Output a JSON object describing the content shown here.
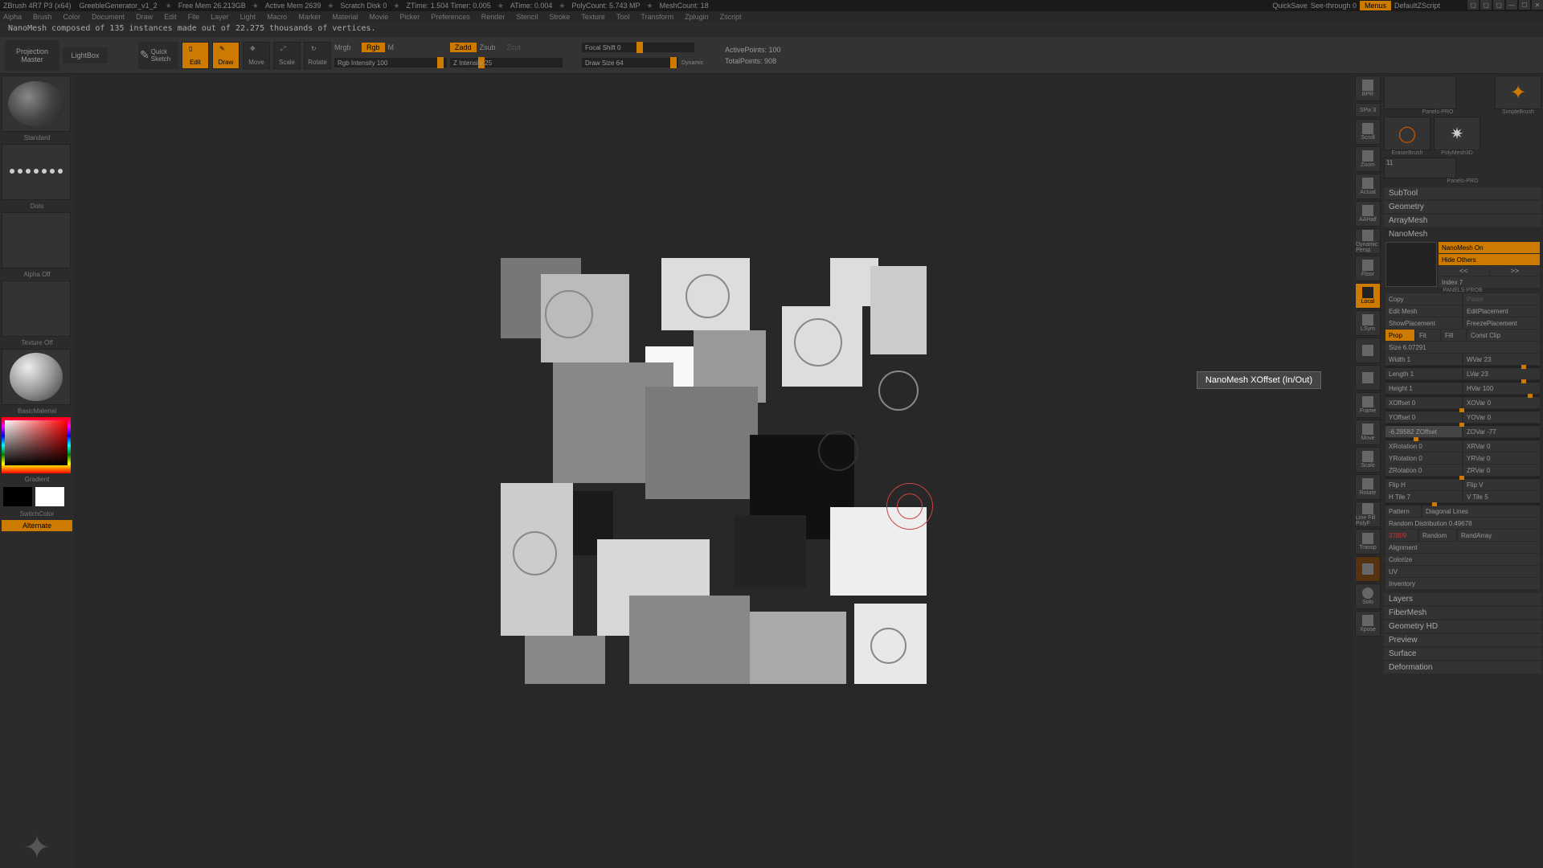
{
  "titlebar": {
    "app": "ZBrush 4R7 P3 (x64)",
    "project": "GreebleGenerator_v1_2",
    "stats": [
      "Free Mem 26.213GB",
      "Active Mem 2639",
      "Scratch Disk 0",
      "ZTime: 1.504 Timer: 0.005",
      "ATime: 0.004",
      "PolyCount: 5.743 MP",
      "MeshCount: 18"
    ],
    "quicksave": "QuickSave",
    "seethrough": "See-through  0",
    "menus": "Menus",
    "script": "DefaultZScript"
  },
  "menubar": [
    "Alpha",
    "Brush",
    "Color",
    "Document",
    "Draw",
    "Edit",
    "File",
    "Layer",
    "Light",
    "Macro",
    "Marker",
    "Material",
    "Movie",
    "Picker",
    "Preferences",
    "Render",
    "Stencil",
    "Stroke",
    "Texture",
    "Tool",
    "Transform",
    "Zplugin",
    "Zscript"
  ],
  "status": "NanoMesh composed of 135 instances made out of 22.275 thousands of vertices.",
  "toolbar": {
    "proj_master": "Projection Master",
    "lightbox": "LightBox",
    "quick_sketch": "Quick Sketch",
    "edit": "Edit",
    "draw": "Draw",
    "move": "Move",
    "scale": "Scale",
    "rotate": "Rotate",
    "mrgb": "Mrgb",
    "rgb": "Rgb",
    "m": "M",
    "rgb_intensity": "Rgb Intensity 100",
    "zadd": "Zadd",
    "zsub": "Zsub",
    "zcut": "Zcut",
    "z_intensity": "Z Intensity 25",
    "focal_shift": "Focal Shift 0",
    "draw_size": "Draw Size 64",
    "dynamic": "Dynamic",
    "active_points": "ActivePoints: 100",
    "total_points": "TotalPoints: 908"
  },
  "left": {
    "standard": "Standard",
    "dots": "Dots",
    "alpha_off": "Alpha Off",
    "texture_off": "Texture Off",
    "material": "BasicMaterial",
    "gradient": "Gradient",
    "switchcolor": "SwitchColor",
    "alternate": "Alternate"
  },
  "tooltip": "NanoMesh XOffset (In/Out)",
  "rtools": [
    "BPR",
    "SPix 3",
    "Scroll",
    "Zoom",
    "Actual",
    "AAHalf",
    "Dynamic Persp",
    "",
    "Floor",
    "Local",
    "LSym",
    "",
    "",
    "Frame",
    "Move",
    "Scale",
    "Rotate",
    "Line Fill PolyF",
    "Transp",
    "",
    "Solo",
    "Xpose"
  ],
  "thumbs": [
    {
      "label": "Panels-PRO"
    },
    {
      "label": "SimpleBrush"
    },
    {
      "label": "EraserBrush"
    },
    {
      "label": "PolyMesh3D"
    },
    {
      "label": "11"
    },
    {
      "label": "Panels-PRO"
    }
  ],
  "sections": [
    "SubTool",
    "Geometry",
    "ArrayMesh",
    "NanoMesh"
  ],
  "nanomesh": {
    "on": "NanoMesh On",
    "hide": "Hide Others",
    "prev": "<<",
    "next": ">>",
    "index": "Index 7",
    "thumb_label": "PANELS-PROB",
    "copy": "Copy",
    "paste": "Paste",
    "edit_mesh": "Edit Mesh",
    "edit_placement": "EditPlacement",
    "show_placement": "ShowPlacement",
    "freeze_placement": "FreezePlacement",
    "prop": "Prop",
    "fit": "Fit",
    "fill": "Fill",
    "const_clip": "Const Clip",
    "size": "Size 6.07291",
    "width": "Width 1",
    "wvar": "WVar 23",
    "length": "Length 1",
    "lvar": "LVar 23",
    "height": "Height 1",
    "hvar": "HVar 100",
    "xoffset": "XOffset 0",
    "xovar": "XOVar 0",
    "yoffset": "YOffset 0",
    "yovar": "YOVar 0",
    "zoffset_special": "-6.28582 ZOffset",
    "zovar": "ZOVar -77",
    "xrotation": "XRotation 0",
    "xrvar": "XRVar 0",
    "yrotation": "YRotation 0",
    "yrvar": "YRVar 0",
    "zrotation": "ZRotation 0",
    "zrvar": "ZRVar 0",
    "flip_h": "Flip H",
    "flip_v": "Flip V",
    "htile": "H Tile 7",
    "vtile": "V Tile 5",
    "pattern": "Pattern",
    "pattern_val": "Diagonal Lines",
    "random_dist": "Random Distribution 0.49678",
    "seed": "37809",
    "random": "Random",
    "randarray": "RandArray",
    "alignment": "Alignment",
    "colorize": "Colorize",
    "uv": "UV",
    "inventory": "Inventory"
  },
  "sections_below": [
    "Layers",
    "FiberMesh",
    "Geometry HD",
    "Preview",
    "Surface",
    "Deformation"
  ]
}
